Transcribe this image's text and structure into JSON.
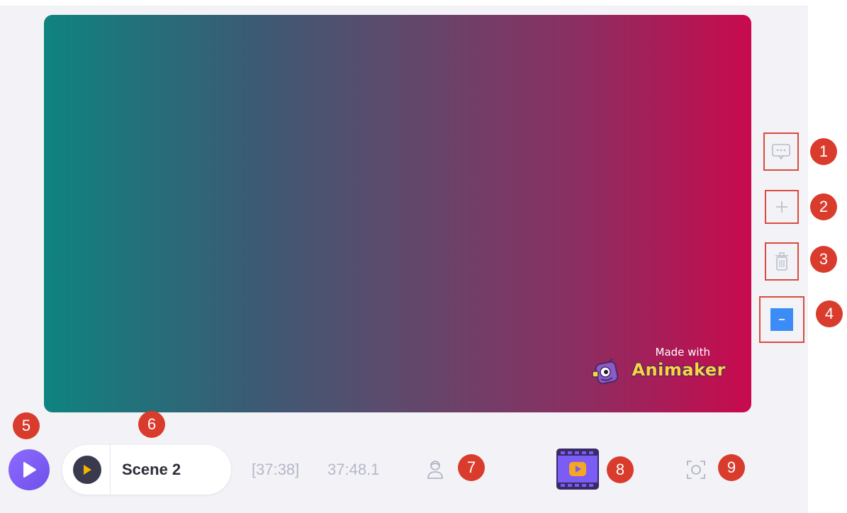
{
  "canvas": {
    "watermark": {
      "made_with": "Made with",
      "brand": "Animaker"
    }
  },
  "side_tools": [
    {
      "icon": "comment-icon",
      "badge": "1"
    },
    {
      "icon": "plus-icon",
      "badge": "2"
    },
    {
      "icon": "trash-icon",
      "badge": "3"
    },
    {
      "icon": "minus-icon",
      "badge": "4",
      "accent": "#3b8df5"
    }
  ],
  "player": {
    "play_badge": "5",
    "scene_label": "Scene 2",
    "scene_badge": "6",
    "time_range": "[37:38]",
    "time_total": "37:48.1",
    "character_badge": "7",
    "preview_badge": "8",
    "fullscreen_badge": "9"
  },
  "colors": {
    "gradient_start": "#0f8380",
    "gradient_end": "#c80a4d",
    "play_accent": "#7b5cf5",
    "badge_red": "#d93b2d"
  }
}
